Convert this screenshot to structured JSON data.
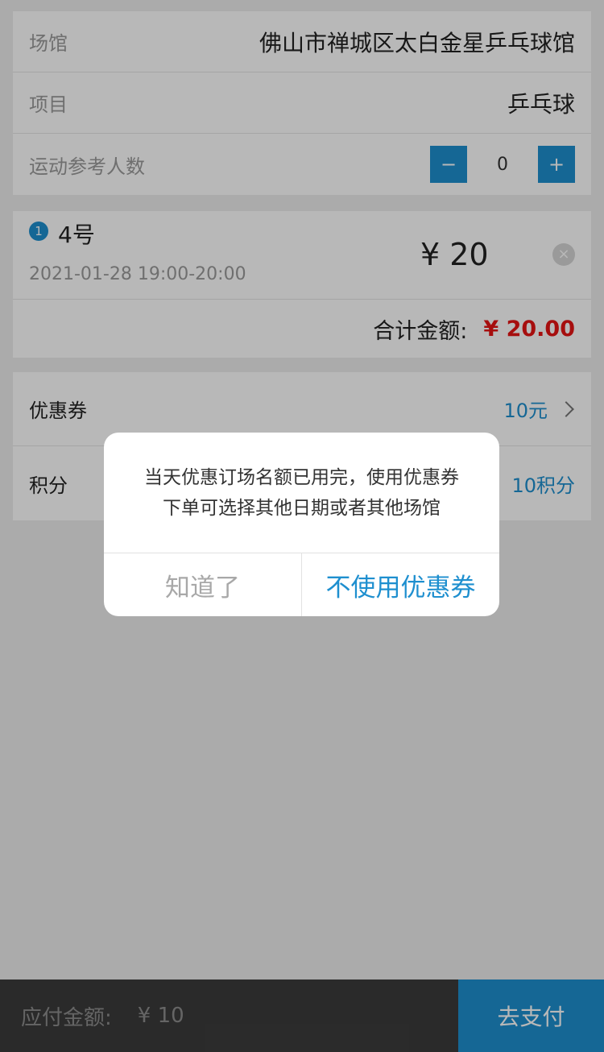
{
  "venue": {
    "label": "场馆",
    "value": "佛山市禅城区太白金星乒乓球馆"
  },
  "project": {
    "label": "项目",
    "value": "乒乓球"
  },
  "participants": {
    "label": "运动参考人数",
    "decrement": "−",
    "count": "0",
    "increment": "+"
  },
  "booking": {
    "slot": {
      "index": "1",
      "court": "4号",
      "time": "2021-01-28 19:00-20:00",
      "price": "¥ 20",
      "remove_glyph": "×"
    },
    "total_label": "合计金额:",
    "total_value": "¥ 20.00"
  },
  "coupon": {
    "label": "优惠券",
    "value": "10元"
  },
  "points": {
    "label": "积分",
    "value": "10积分"
  },
  "footer": {
    "pay_label": "应付金额:",
    "pay_amount": "¥ 10",
    "pay_button": "去支付"
  },
  "dialog": {
    "message_lines": [
      "当天优惠订场名额已用完，使用优惠券",
      "下单可选择其他日期或者其他场馆"
    ],
    "dismiss_label": "知道了",
    "confirm_label": "不使用优惠券"
  },
  "colors": {
    "accent": "#1e8fcf",
    "price_red": "#e61414",
    "footer_bg": "#3b3b3b"
  },
  "icons": {
    "remove": "close-circle-icon",
    "coupon_arrow": "chevron-right-icon",
    "slot_badge": "number-badge-icon"
  }
}
